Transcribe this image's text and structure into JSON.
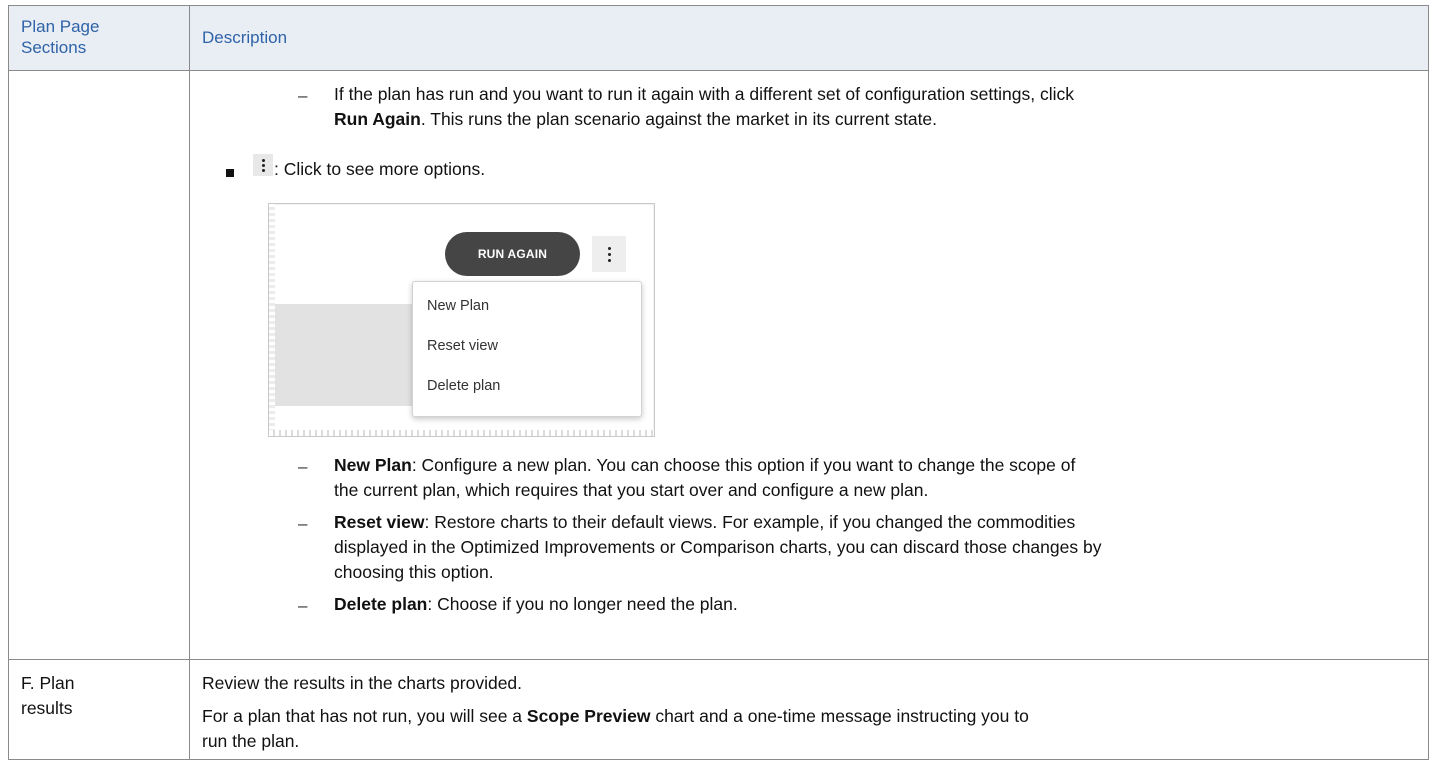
{
  "table": {
    "headers": [
      "Plan Page Sections",
      "Description"
    ],
    "header_col1_lines": [
      "Plan Page",
      "Sections"
    ]
  },
  "row1": {
    "run_again_item": {
      "line1": "If the plan has run and you want to run it again with a different set of configuration settings, click",
      "bold": "Run Again",
      "rest": ". This runs the plan scenario against the market in its current state."
    },
    "more_options_text": ": Click to see more options.",
    "screenshot": {
      "run_again_button": "RUN AGAIN",
      "menu_items": [
        "New Plan",
        "Reset view",
        "Delete plan"
      ]
    },
    "sub_items": [
      {
        "bold": "New Plan",
        "line1": ": Configure a new plan. You can choose this option if you want to change the scope of",
        "line2": "the current plan, which requires that you start over and configure a new plan."
      },
      {
        "bold": "Reset view",
        "line1": ": Restore charts to their default views. For example, if you changed the commodities",
        "line2": "displayed in the Optimized Improvements or Comparison charts, you can discard those changes by",
        "line3": "choosing this option."
      },
      {
        "bold": "Delete plan",
        "line1": ": Choose if you no longer need the plan."
      }
    ]
  },
  "row2": {
    "section_lines": [
      "F. Plan",
      "results"
    ],
    "para1": "Review the results in the charts provided.",
    "para2_pre": "For a plan that has not run, you will see a ",
    "para2_bold": "Scope Preview",
    "para2_post": " chart and a one-time message instructing you to",
    "para2_line2": "run the plan."
  }
}
